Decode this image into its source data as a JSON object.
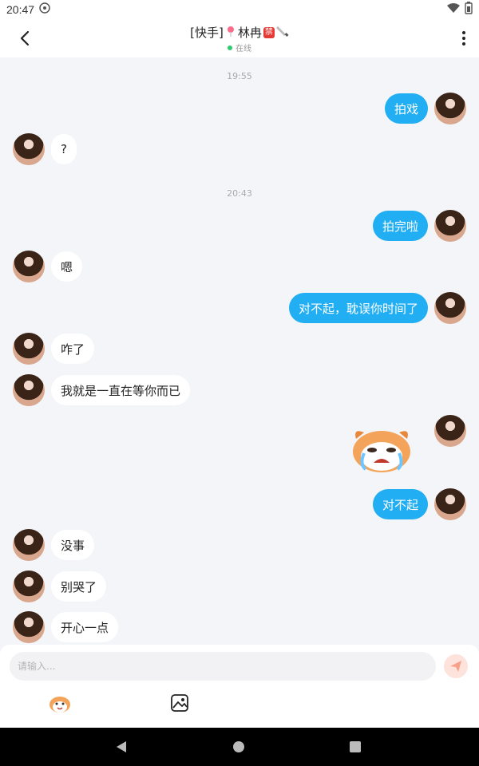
{
  "status_bar": {
    "time": "20:47"
  },
  "header": {
    "title_prefix": "[快手]",
    "title_name": "林冉",
    "ban_badge": "禁",
    "online_status": "在线"
  },
  "chat": {
    "timestamps": [
      "19:55",
      "20:43"
    ],
    "messages": [
      {
        "side": "out",
        "text": "拍戏"
      },
      {
        "side": "in",
        "text": "?"
      },
      {
        "side": "out",
        "text": "拍完啦"
      },
      {
        "side": "in",
        "text": "嗯"
      },
      {
        "side": "out",
        "text": "对不起，耽误你时间了"
      },
      {
        "side": "in",
        "text": "咋了"
      },
      {
        "side": "in",
        "text": "我就是一直在等你而已"
      },
      {
        "side": "out",
        "text": "对不起"
      },
      {
        "side": "in",
        "text": "没事"
      },
      {
        "side": "in",
        "text": "别哭了"
      },
      {
        "side": "in",
        "text": "开心一点"
      }
    ]
  },
  "composer": {
    "placeholder": "请输入...",
    "value": ""
  },
  "icons": {
    "back": "back-arrow-icon",
    "more": "more-vertical-icon",
    "send": "send-icon",
    "emoji": "emoji-icon",
    "image": "image-icon"
  },
  "colors": {
    "outgoing_bubble": "#22aef2",
    "incoming_bubble": "#ffffff",
    "chat_background": "#f4f5f8",
    "online_dot": "#2ecc71",
    "send_button_bg": "#fde3dc"
  }
}
